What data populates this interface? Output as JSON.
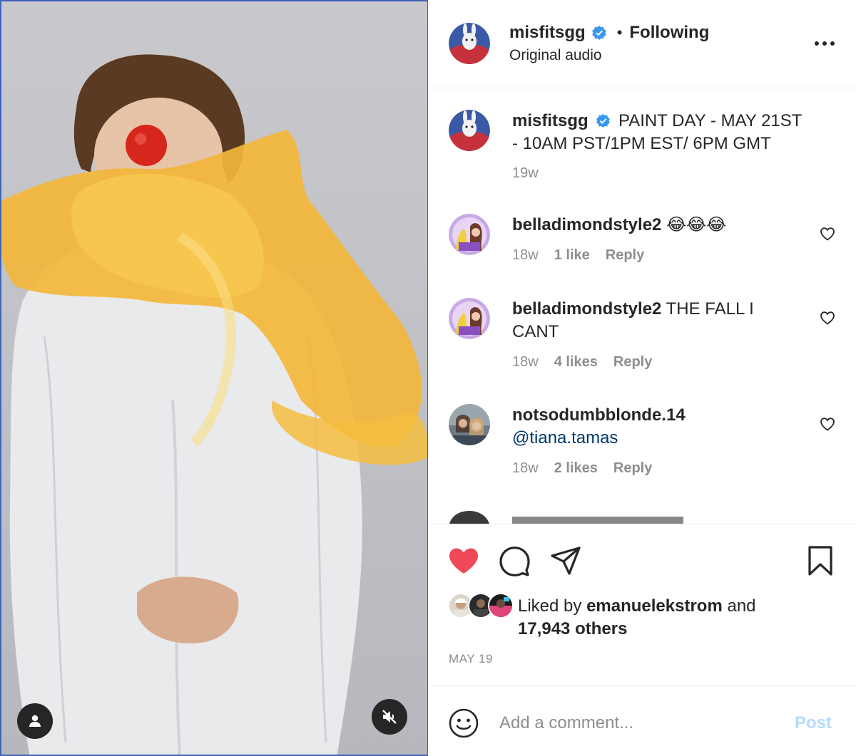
{
  "header": {
    "username": "misfitsgg",
    "separator": "•",
    "follow_status": "Following",
    "audio": "Original audio"
  },
  "caption": {
    "username": "misfitsgg",
    "text": "PAINT DAY - MAY 21ST - 10AM PST/1PM EST/ 6PM GMT",
    "age": "19w"
  },
  "comments": [
    {
      "username": "belladimondstyle2",
      "text": "😂😂😂",
      "age": "18w",
      "likes": "1 like",
      "reply": "Reply"
    },
    {
      "username": "belladimondstyle2",
      "text": "THE FALL I CANT",
      "age": "18w",
      "likes": "4 likes",
      "reply": "Reply"
    },
    {
      "username": "notsodumbblonde.14",
      "text": "@tiana.tamas",
      "age": "18w",
      "likes": "2 likes",
      "reply": "Reply"
    }
  ],
  "likes": {
    "prefix": "Liked by",
    "user": "emanuelekstrom",
    "conj": "and",
    "others": "17,943 others"
  },
  "date": "MAY 19",
  "add_comment": {
    "placeholder": "Add a comment...",
    "post_label": "Post"
  },
  "colors": {
    "like_red": "#ed4956",
    "verified_blue": "#3897f0",
    "link": "#00376b",
    "post_disabled": "#b3dbff",
    "muted": "#8e8e8e"
  },
  "icons": [
    "verified-icon",
    "more-icon",
    "heart-icon",
    "comment-icon",
    "share-icon",
    "bookmark-icon",
    "smile-icon",
    "user-tag-icon",
    "muted-speaker-icon"
  ]
}
